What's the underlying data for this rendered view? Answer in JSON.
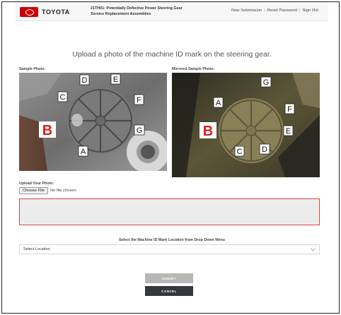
{
  "header": {
    "logo_text": "TOYOTA",
    "title_line1": "21TH01: Potentially Defective Power Steering Gear",
    "title_line2": "Service Replacement Assemblies",
    "links": {
      "new_submission": "New Submission",
      "reset_password": "Reset Password",
      "sign_out": "Sign Out",
      "separator": "|"
    }
  },
  "page_title": "Upload a photo of the machine ID mark on the steering gear.",
  "sample_photo": {
    "label": "Sample Photo:",
    "marks": {
      "A": "A",
      "B": "B",
      "C": "C",
      "D": "D",
      "E": "E",
      "F": "F",
      "G": "G"
    }
  },
  "mirrored_photo": {
    "label": "Mirrored Sample Photo:",
    "marks": {
      "A": "A",
      "B": "B",
      "C": "C",
      "D": "D",
      "E": "E",
      "F": "F",
      "G": "G"
    }
  },
  "upload": {
    "label": "Upload Your Photo:",
    "choose_file": "Choose File",
    "no_file": "No file chosen"
  },
  "location": {
    "label": "Select the Machine ID Mark Location from Drop Down Menu",
    "selected": "Select Location"
  },
  "buttons": {
    "submit": "SUBMIT",
    "cancel": "CANCEL"
  },
  "colors": {
    "brand_red": "#cc0000",
    "accent_border": "#d8453f",
    "cancel_bg": "#34393f",
    "submit_bg": "#b7b7b7"
  }
}
